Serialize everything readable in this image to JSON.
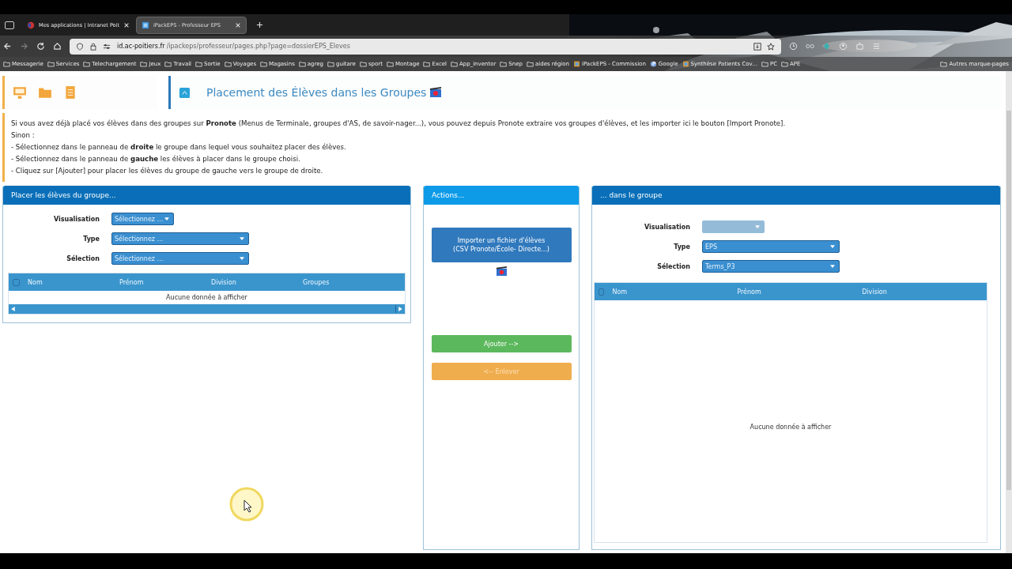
{
  "browser": {
    "tabs": [
      {
        "title": "Mes applications | Intranet Poit",
        "selected": false
      },
      {
        "title": "iPackEPS - Professeur EPS",
        "selected": true
      }
    ],
    "url": {
      "host": "id.ac-poitiers.fr",
      "path": "/ipackeps/professeur/pages.php?page=dossierEPS_Eleves"
    },
    "bookmarks": [
      {
        "label": "Messagerie",
        "kind": "folder"
      },
      {
        "label": "Services",
        "kind": "folder"
      },
      {
        "label": "Telechargement",
        "kind": "folder"
      },
      {
        "label": "Jeux",
        "kind": "folder"
      },
      {
        "label": "Travail",
        "kind": "folder"
      },
      {
        "label": "Sortie",
        "kind": "folder"
      },
      {
        "label": "Voyages",
        "kind": "folder"
      },
      {
        "label": "Magasins",
        "kind": "folder"
      },
      {
        "label": "agreg",
        "kind": "folder"
      },
      {
        "label": "guitare",
        "kind": "folder"
      },
      {
        "label": "sport",
        "kind": "folder"
      },
      {
        "label": "Montage",
        "kind": "folder"
      },
      {
        "label": "Excel",
        "kind": "folder"
      },
      {
        "label": "App_inventor",
        "kind": "folder"
      },
      {
        "label": "Snep",
        "kind": "folder"
      },
      {
        "label": "aides région",
        "kind": "folder"
      },
      {
        "label": "iPackEPS - Commission",
        "kind": "site"
      },
      {
        "label": "Google",
        "kind": "google"
      },
      {
        "label": "Synthèse Patients Cov...",
        "kind": "site"
      },
      {
        "label": "PC",
        "kind": "folder"
      },
      {
        "label": "APE",
        "kind": "folder"
      }
    ],
    "other_bookmarks": "Autres marque-pages"
  },
  "page": {
    "title": "Placement des Élèves dans les Groupes",
    "intro": [
      "Si vous avez déjà placé vos élèves dans des groupes sur **Pronote** (Menus de Terminale, groupes d'AS, de savoir-nager...), vous pouvez depuis Pronote extraire vos groupes d'élèves, et les importer ici le bouton [Import Pronote].",
      "Sinon :",
      "- Sélectionnez dans le panneau de **droite** le groupe dans lequel vous souhaitez placer des élèves.",
      "- Sélectionnez dans le panneau de **gauche** les élèves à placer dans le groupe choisi.",
      "- Cliquez sur [Ajouter] pour placer les élèves du groupe de gauche vers le groupe de droite."
    ],
    "left_panel": {
      "title": "Placer les élèves du groupe...",
      "fields": [
        {
          "label": "Visualisation",
          "value": "Sélectionnez ...",
          "disabled": false
        },
        {
          "label": "Type",
          "value": "Sélectionnez ...",
          "disabled": false
        },
        {
          "label": "Sélection",
          "value": "Sélectionnez ...",
          "disabled": false
        }
      ],
      "table": {
        "select_all_checked": false,
        "columns": [
          "Nom",
          "Prénom",
          "Division",
          "Groupes"
        ],
        "empty_text": "Aucune donnée à afficher"
      }
    },
    "actions": {
      "title": "Actions...",
      "buttons": [
        {
          "label": "Importer un fichier d'élèves\n(CSV Pronote/École- Directe...)",
          "kind": "import",
          "disabled": false
        },
        {
          "label": "Ajouter -->",
          "kind": "add",
          "disabled": false
        },
        {
          "label": "<-- Enlever",
          "kind": "remove",
          "disabled": true
        }
      ]
    },
    "right_panel": {
      "title": "... dans le groupe",
      "fields": [
        {
          "label": "Visualisation",
          "disabled": true
        },
        {
          "label": "Type",
          "value": "EPS",
          "disabled": false
        },
        {
          "label": "Sélection",
          "value": "Terms_P3",
          "disabled": false
        }
      ],
      "table": {
        "select_all_checked": false,
        "columns": [
          "Nom",
          "Prénom",
          "Division"
        ],
        "empty_text": "Aucune donnée à afficher"
      }
    }
  }
}
